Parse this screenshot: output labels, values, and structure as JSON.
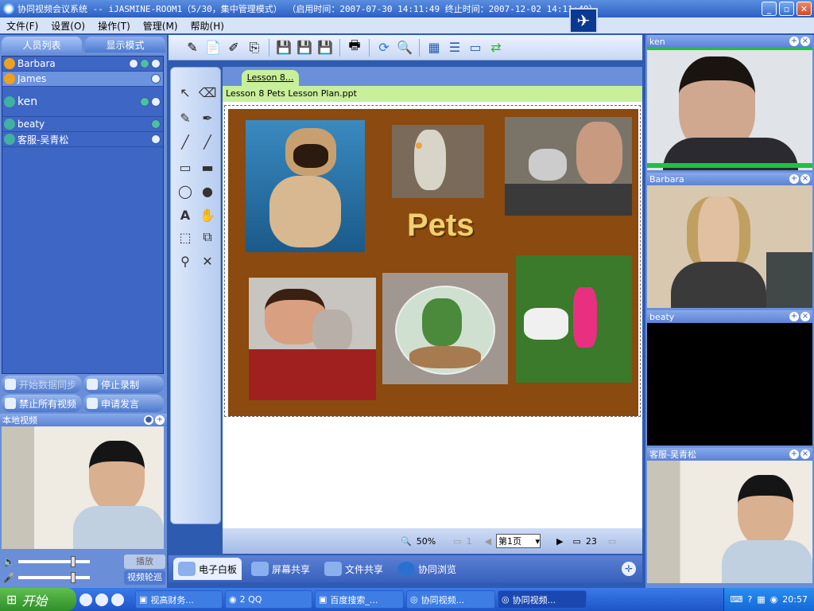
{
  "titlebar": {
    "text": "协同视频会议系统 -- iJASMINE-ROOM1（5/30，集中管理模式）    （启用时间：2007-07-30 14:11:49  终止时间：2007-12-02 14:11:49）",
    "min": "_",
    "restore": "▫",
    "close": "✕"
  },
  "menu": [
    "文件(F)",
    "设置(O)",
    "操作(T)",
    "管理(M)",
    "帮助(H)"
  ],
  "left": {
    "tabs": [
      "人员列表",
      "显示模式"
    ],
    "users": [
      "Barbara",
      "James",
      "ken",
      "beaty",
      "客服-吴青松"
    ],
    "buttons": [
      "开始数据同步",
      "停止录制",
      "禁止所有视频",
      "申请发言"
    ],
    "local_video_title": "本地视频",
    "play_btn": "播放",
    "rotate_btn": "视频轮巡"
  },
  "board": {
    "tab": "Lesson 8...",
    "file": "Lesson 8 Pets Lesson Plan.ppt",
    "slide_title": "Pets",
    "zoom": "50%",
    "first_page": "1",
    "page_select": "第1页",
    "total_pages": "23"
  },
  "bottom_tabs": [
    "电子白板",
    "屏幕共享",
    "文件共享",
    "协同浏览"
  ],
  "right": {
    "videos": [
      "ken",
      "Barbara",
      "beaty",
      "客服-吴青松"
    ]
  },
  "taskbar": {
    "start": "开始",
    "tasks": [
      "视高财务...",
      "2 QQ",
      "百度搜索_...",
      "协同视频...",
      "协同视频..."
    ],
    "time": "20:57"
  },
  "colors": {
    "panel": "#6a8fd8",
    "slide_bg": "#8a4a10",
    "title_gold": "#f0d070"
  }
}
